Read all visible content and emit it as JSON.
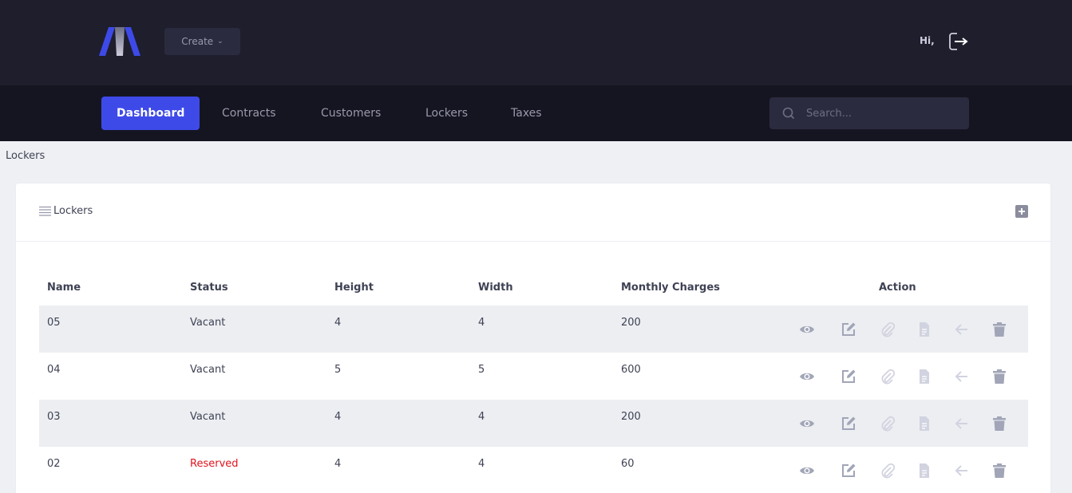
{
  "header": {
    "create_label": "Create",
    "greeting": "Hi,"
  },
  "nav": {
    "items": [
      {
        "label": "Dashboard",
        "active": true
      },
      {
        "label": "Contracts",
        "active": false
      },
      {
        "label": "Customers",
        "active": false
      },
      {
        "label": "Lockers",
        "active": false
      },
      {
        "label": "Taxes",
        "active": false
      }
    ],
    "search_placeholder": "Search..."
  },
  "breadcrumb": "Lockers",
  "card": {
    "title": "Lockers",
    "columns": [
      "Name",
      "Status",
      "Height",
      "Width",
      "Monthly Charges",
      "Action"
    ],
    "rows": [
      {
        "name": "05",
        "status": "Vacant",
        "height": "4",
        "width": "4",
        "charges": "200"
      },
      {
        "name": "04",
        "status": "Vacant",
        "height": "5",
        "width": "5",
        "charges": "600"
      },
      {
        "name": "03",
        "status": "Vacant",
        "height": "4",
        "width": "4",
        "charges": "200"
      },
      {
        "name": "02",
        "status": "Reserved",
        "height": "4",
        "width": "4",
        "charges": "60"
      }
    ],
    "action_icons": [
      "eye-icon",
      "edit-icon",
      "paperclip-icon",
      "document-icon",
      "arrow-left-icon",
      "trash-icon"
    ]
  },
  "colors": {
    "accent": "#3e4ae8",
    "header_bg": "#1e1e2d",
    "nav_bg": "#151521",
    "reserved": "#e1131d"
  }
}
